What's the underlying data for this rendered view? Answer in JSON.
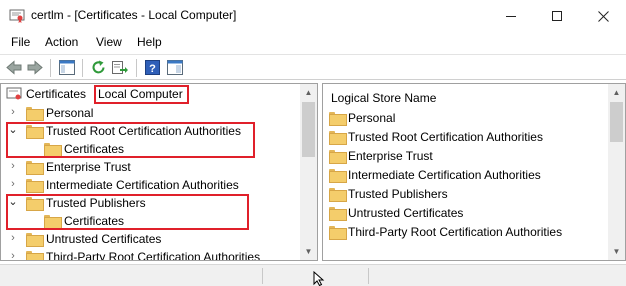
{
  "window": {
    "title": "certlm - [Certificates - Local Computer]"
  },
  "menu": {
    "items": [
      "File",
      "Action",
      "View",
      "Help"
    ]
  },
  "toolbar": {
    "icons": [
      "back-arrow-icon",
      "forward-arrow-icon",
      "show-hide-console-tree-icon",
      "refresh-icon",
      "export-list-icon",
      "help-icon",
      "action-pane-icon"
    ]
  },
  "tree": {
    "root_label": "Certificates",
    "root_label_highlight": "Local Computer",
    "items": [
      {
        "label": "Personal",
        "expanded": false
      },
      {
        "label": "Trusted Root Certification Authorities",
        "expanded": true,
        "child": "Certificates"
      },
      {
        "label": "Enterprise Trust",
        "expanded": false
      },
      {
        "label": "Intermediate Certification Authorities",
        "expanded": false
      },
      {
        "label": "Trusted Publishers",
        "expanded": true,
        "child": "Certificates"
      },
      {
        "label": "Untrusted Certificates",
        "expanded": false
      },
      {
        "label": "Third-Party Root Certification Authorities",
        "expanded": false
      }
    ]
  },
  "list": {
    "header": "Logical Store Name",
    "items": [
      "Personal",
      "Trusted Root Certification Authorities",
      "Enterprise Trust",
      "Intermediate Certification Authorities",
      "Trusted Publishers",
      "Untrusted Certificates",
      "Third-Party Root Certification Authorities"
    ]
  },
  "colors": {
    "highlight_box": "#e0202a",
    "folder_fill": "#f4cd6b"
  }
}
